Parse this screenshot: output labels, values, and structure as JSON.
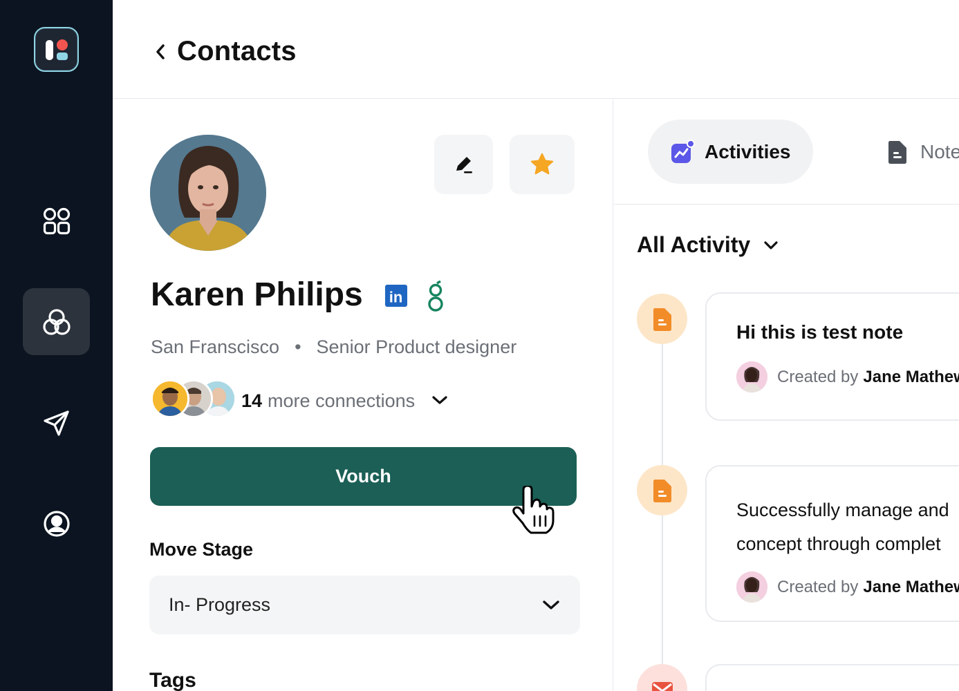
{
  "sidebar": {
    "logo": "app-logo",
    "items": [
      {
        "icon": "apps-grid-icon",
        "active": false
      },
      {
        "icon": "contacts-circles-icon",
        "active": true
      },
      {
        "icon": "send-icon",
        "active": false
      },
      {
        "icon": "user-circle-icon",
        "active": false
      }
    ]
  },
  "header": {
    "back_icon": "chevron-left-icon",
    "title": "Contacts"
  },
  "profile": {
    "name": "Karen Philips",
    "location": "San Franscisco",
    "separator": "•",
    "role": "Senior Product designer",
    "connections_count": "14",
    "connections_label": "more connections",
    "vouch_label": "Vouch",
    "move_stage_label": "Move Stage",
    "stage_value": "In- Progress",
    "tags_label": "Tags",
    "linkedin_text": "in"
  },
  "activity": {
    "tabs": [
      {
        "label": "Activities",
        "icon": "activity-chart-icon",
        "active": true
      },
      {
        "label": "Notes",
        "icon": "document-icon",
        "active": false
      }
    ],
    "filter_label": "All Activity",
    "items": [
      {
        "type": "note",
        "lines": [
          "Hi this is test note"
        ],
        "created_prefix": "Created by",
        "created_by": "Jane Mathews"
      },
      {
        "type": "note",
        "lines": [
          "Successfully manage and",
          "concept through complet"
        ],
        "created_prefix": "Created by",
        "created_by": "Jane Mathews"
      },
      {
        "type": "email"
      }
    ]
  },
  "colors": {
    "sidebar_bg": "#0b1420",
    "vouch_bg": "#1b5f56",
    "star": "#f5a623",
    "note_dot": "#fde6c8",
    "note_icon": "#f28c28",
    "activities_icon": "#5b57e8",
    "linkedin": "#1f66c2",
    "green_logo": "#16845f"
  }
}
